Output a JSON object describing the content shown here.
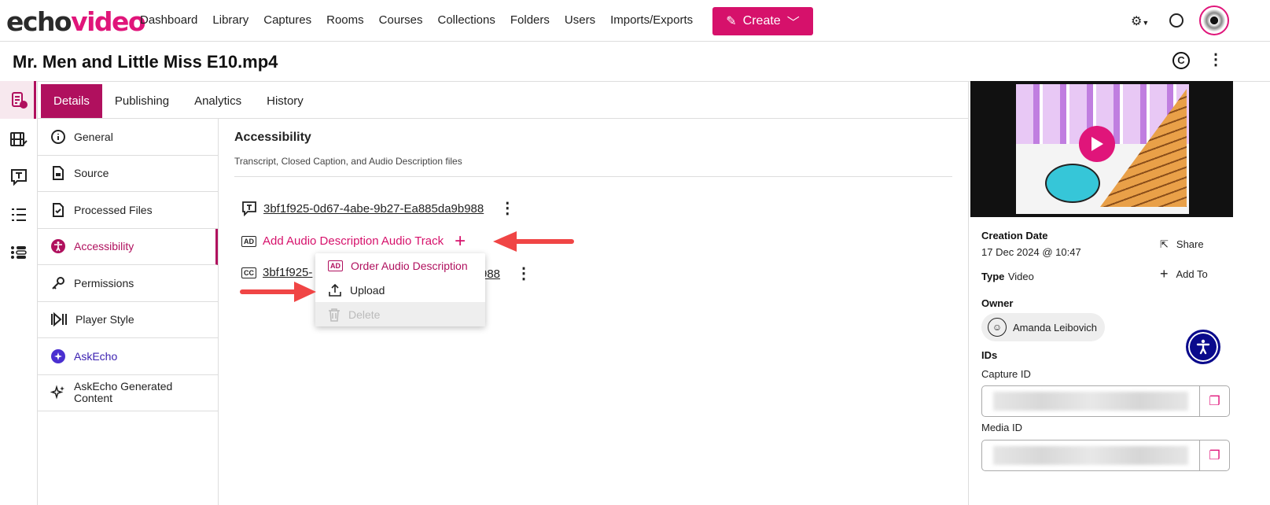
{
  "brand": {
    "part1": "echo",
    "part2": "video"
  },
  "nav": [
    "Dashboard",
    "Library",
    "Captures",
    "Rooms",
    "Courses",
    "Collections",
    "Folders",
    "Users",
    "Imports/Exports"
  ],
  "create_label": "Create",
  "page_title": "Mr. Men and Little Miss E10.mp4",
  "tabs": [
    "Details",
    "Publishing",
    "Analytics",
    "History"
  ],
  "menu": [
    "General",
    "Source",
    "Processed Files",
    "Accessibility",
    "Permissions",
    "Player Style",
    "AskEcho",
    "AskEcho Generated Content"
  ],
  "section": {
    "title": "Accessibility",
    "subtitle": "Transcript, Closed Caption, and Audio Description files"
  },
  "files": {
    "transcript": "3bf1f925-0d67-4abe-9b27-Ea885da9b988",
    "caption_start": "3bf1f925-",
    "caption_end": "988"
  },
  "add_ad_label": "Add Audio Description Audio Track",
  "dropdown": [
    "Order Audio Description",
    "Upload",
    "Delete"
  ],
  "info": {
    "creation_label": "Creation Date",
    "creation_value": "17 Dec 2024 @ 10:47",
    "type_label": "Type",
    "type_value": "Video",
    "owner_label": "Owner",
    "owner_name": "Amanda Leibovich",
    "ids_label": "IDs",
    "capture_label": "Capture ID",
    "media_label": "Media ID",
    "share": "Share",
    "add_to": "Add To"
  },
  "colors": {
    "accent": "#b0105e",
    "brand": "#e0157a",
    "arrow": "#f04545",
    "a11y": "#0a0a8c"
  }
}
